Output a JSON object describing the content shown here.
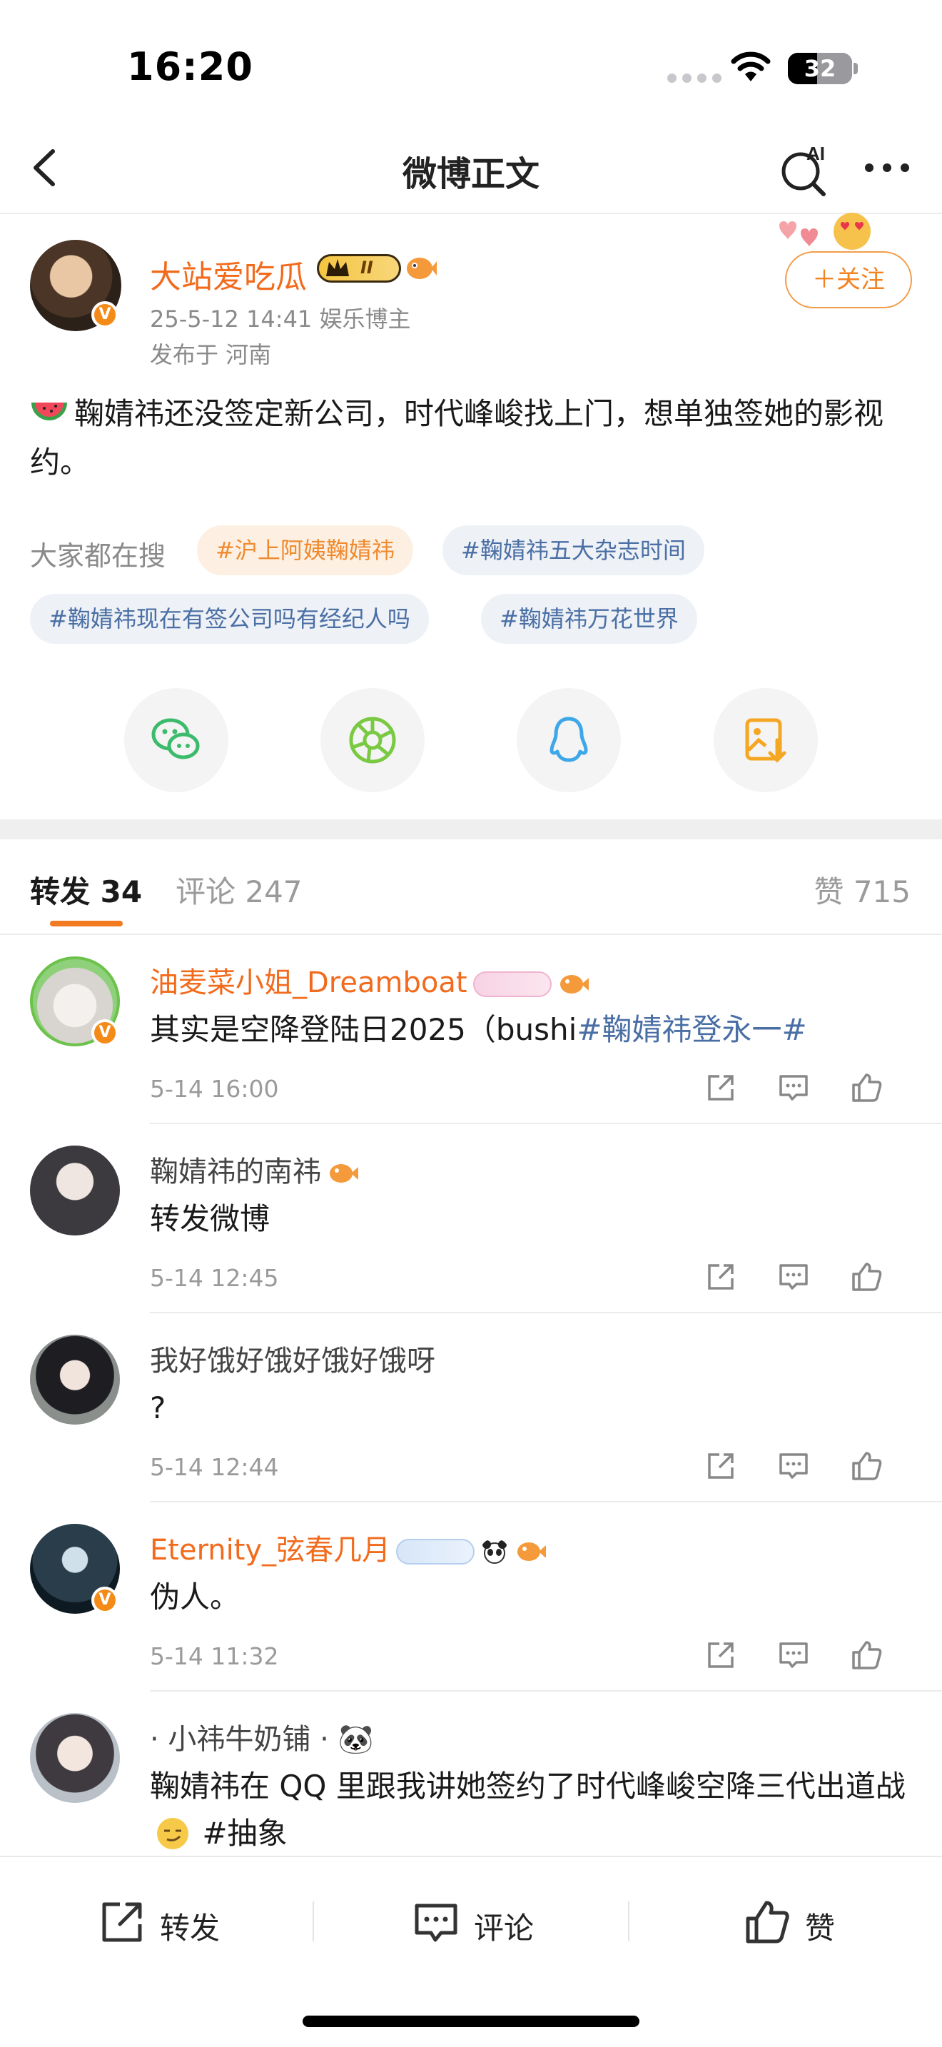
{
  "status_bar": {
    "time": "16:20",
    "battery": "32"
  },
  "nav": {
    "title": "微博正文",
    "ai_label": "AI"
  },
  "post": {
    "author": "大站爱吃瓜",
    "level_badge": "II",
    "meta": "25-5-12 14:41  娱乐博主",
    "location": "发布于 河南",
    "follow_label": "＋关注",
    "text": "鞠婧祎还没签定新公司，时代峰峻找上门，想单独签她的影视约。",
    "hot_label": "大家都在搜",
    "hot_topics": [
      "#沪上阿姨鞠婧祎",
      "#鞠婧祎五大杂志时间",
      "#鞠婧祎现在有签公司吗有经纪人吗",
      "#鞠婧祎万花世界"
    ],
    "share_targets": [
      "wechat-icon",
      "moments-icon",
      "qq-icon",
      "save-image-icon"
    ]
  },
  "tabs": {
    "repost": "转发 34",
    "comment": "评论 247",
    "likes": "赞 715"
  },
  "comments": [
    {
      "name": "油麦菜小姐_Dreamboat",
      "text": "其实是空降登陆日2025（bushi",
      "topic": "#鞠婧祎登永一#",
      "time": "5-14 16:00",
      "verified": true
    },
    {
      "name": "鞠婧祎的南祎",
      "text": "转发微博",
      "topic": "",
      "time": "5-14 12:45",
      "verified": false
    },
    {
      "name": "我好饿好饿好饿好饿呀",
      "text": "?",
      "topic": "",
      "time": "5-14 12:44",
      "verified": false
    },
    {
      "name": "Eternity_弦春几月",
      "text": "伪人。",
      "topic": "",
      "time": "5-14 11:32",
      "verified": true
    },
    {
      "name": "· 小祎牛奶铺 · 🐼",
      "text": "鞠婧祎在 QQ 里跟我讲她签约了时代峰峻空降三代出道战",
      "topic": " #抽象",
      "time": "",
      "verified": false
    }
  ],
  "bottom_bar": {
    "repost": "转发",
    "comment": "评论",
    "like": "赞"
  },
  "colors": {
    "accent": "#f26b1d",
    "topic": "#4a6fa5",
    "hot": "#f08a2e"
  }
}
